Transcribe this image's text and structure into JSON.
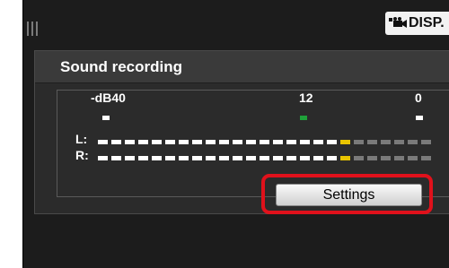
{
  "toolbar": {
    "disp_label": "DISP.",
    "camera_icon": "movie-camera-icon"
  },
  "panel": {
    "title": "Sound recording",
    "scale": {
      "left": "-dB40",
      "mid": "12",
      "right": "0"
    },
    "channels": [
      {
        "label": "L:",
        "level_segments_lit": 19,
        "total_segments": 25
      },
      {
        "label": "R:",
        "level_segments_lit": 19,
        "total_segments": 25
      }
    ],
    "settings_label": "Settings"
  },
  "colors": {
    "accent_highlight": "#e0111b",
    "meter_white": "#ffffff",
    "meter_yellow": "#e8c400",
    "meter_green": "#1fa13a",
    "meter_off": "#7a7a7a"
  }
}
